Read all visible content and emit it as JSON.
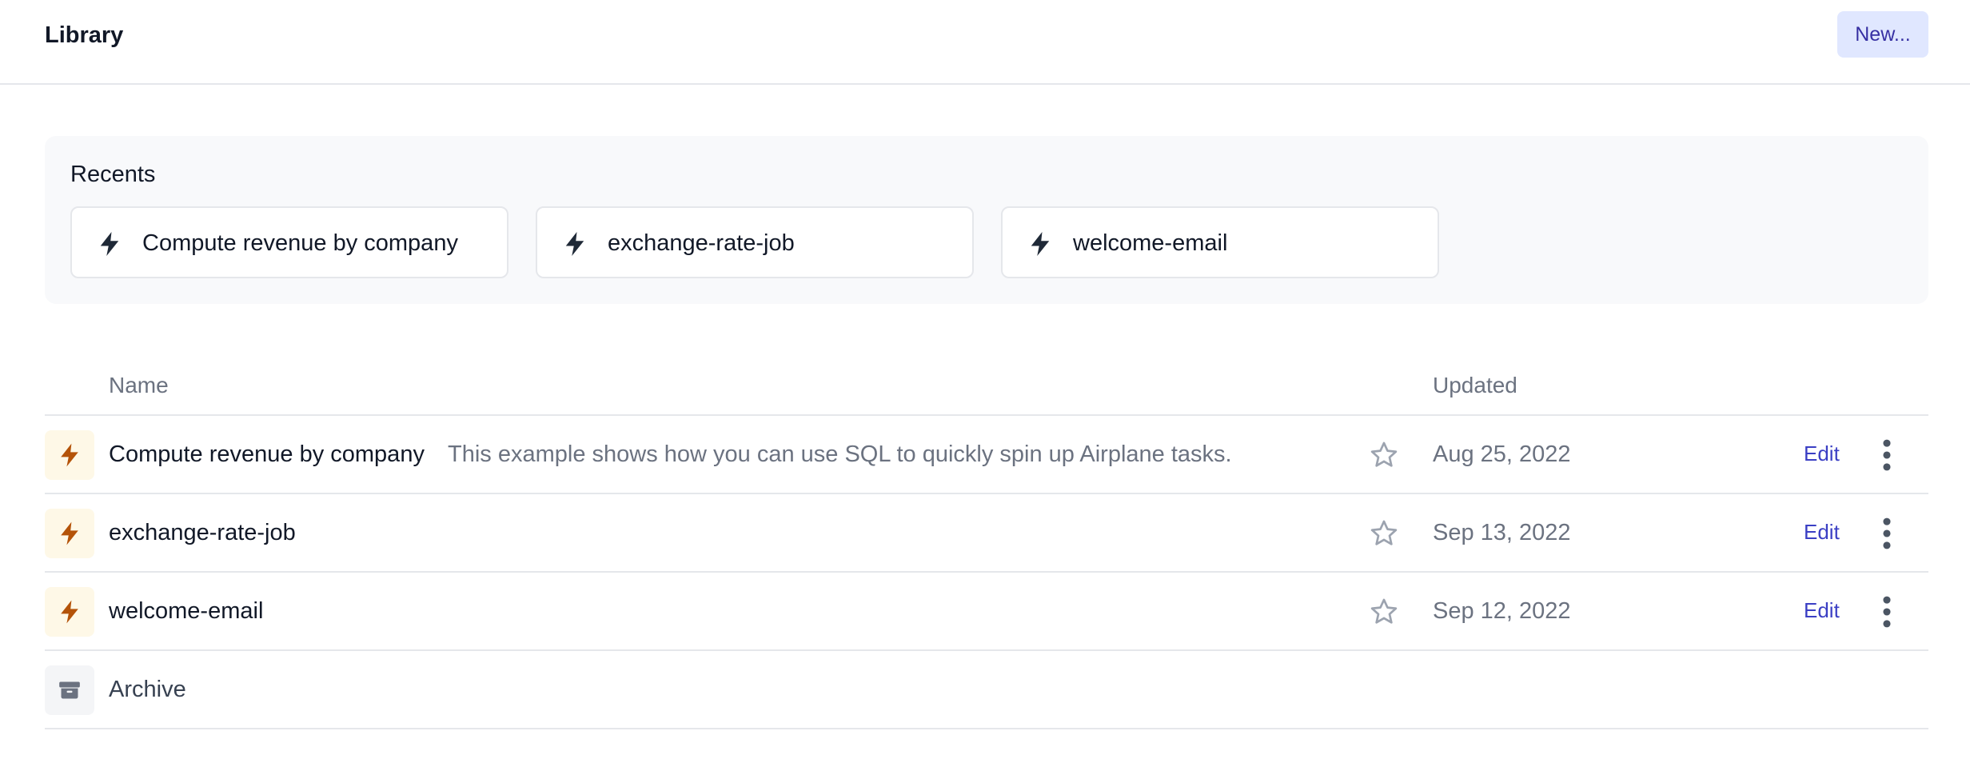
{
  "header": {
    "title": "Library",
    "new_button_label": "New..."
  },
  "recents": {
    "title": "Recents",
    "items": [
      {
        "label": "Compute revenue by company",
        "icon": "bolt-icon"
      },
      {
        "label": "exchange-rate-job",
        "icon": "bolt-icon"
      },
      {
        "label": "welcome-email",
        "icon": "bolt-icon"
      }
    ]
  },
  "table": {
    "columns": {
      "name": "Name",
      "updated": "Updated"
    },
    "rows": [
      {
        "name": "Compute revenue by company",
        "description": "This example shows how you can use SQL to quickly spin up Airplane tasks.",
        "updated": "Aug 25, 2022",
        "edit_label": "Edit",
        "icon": "bolt-icon",
        "starred": false
      },
      {
        "name": "exchange-rate-job",
        "description": "",
        "updated": "Sep 13, 2022",
        "edit_label": "Edit",
        "icon": "bolt-icon",
        "starred": false
      },
      {
        "name": "welcome-email",
        "description": "",
        "updated": "Sep 12, 2022",
        "edit_label": "Edit",
        "icon": "bolt-icon",
        "starred": false
      }
    ],
    "archive": {
      "label": "Archive",
      "icon": "archive-icon"
    }
  },
  "colors": {
    "accent": "#3b3fc4",
    "bolt_dark": "#1f2937",
    "bolt_orange": "#b45309",
    "new_button_bg": "#e0e7ff"
  }
}
